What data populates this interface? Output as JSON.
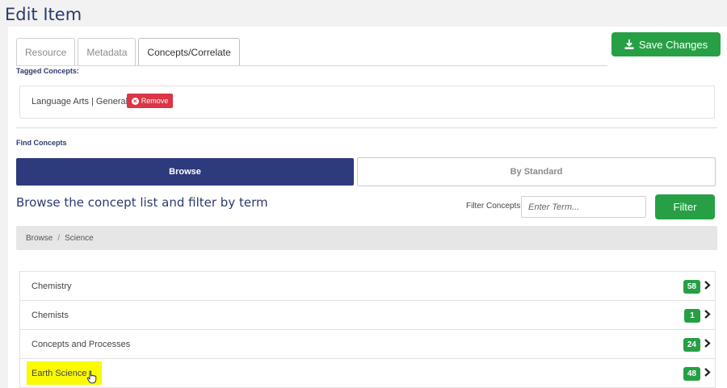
{
  "page": {
    "title": "Edit Item"
  },
  "tabs": [
    {
      "label": "Resource",
      "active": false
    },
    {
      "label": "Metadata",
      "active": false
    },
    {
      "label": "Concepts/Correlate",
      "active": true
    }
  ],
  "toolbar": {
    "save_label": "Save Changes"
  },
  "tagged": {
    "label": "Tagged Concepts:",
    "items": [
      {
        "text": "Language Arts | General",
        "remove_label": "Remove"
      }
    ]
  },
  "find": {
    "label": "Find Concepts",
    "modes": {
      "browse": "Browse",
      "standard": "By Standard"
    },
    "heading": "Browse the concept list and filter by term",
    "filter_label": "Filter Concepts",
    "filter_placeholder": "Enter Term...",
    "filter_button": "Filter"
  },
  "breadcrumb": {
    "items": [
      "Browse",
      "Science"
    ],
    "separator": "/"
  },
  "concepts": [
    {
      "label": "Chemistry",
      "count": "58"
    },
    {
      "label": "Chemists",
      "count": "1"
    },
    {
      "label": "Concepts and Processes",
      "count": "24"
    },
    {
      "label": "Earth Science",
      "count": "48",
      "highlighted": true
    }
  ],
  "colors": {
    "primary": "#2d3a7c",
    "success": "#27a045",
    "danger": "#dc3545",
    "highlight": "#fafa00"
  },
  "icons": {
    "save": "download-icon",
    "remove": "close-circle-icon",
    "row": "chevron-right-icon",
    "cursor": "hand-pointer-icon"
  }
}
